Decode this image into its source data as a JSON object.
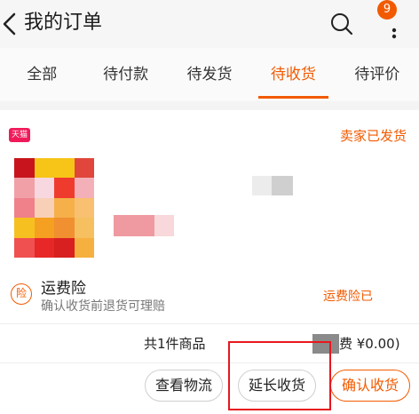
{
  "header": {
    "title": "我的订单",
    "badge": "9"
  },
  "tabs": [
    {
      "label": "全部",
      "active": false
    },
    {
      "label": "待付款",
      "active": false
    },
    {
      "label": "待发货",
      "active": false
    },
    {
      "label": "待收货",
      "active": true
    },
    {
      "label": "待评价",
      "active": false
    }
  ],
  "order": {
    "shop_logo": "天猫",
    "status": "卖家已发货",
    "insurance": {
      "icon_text": "险",
      "title": "运费险",
      "subtitle": "确认收货前退货可理赔",
      "status": "运费险已"
    },
    "summary": {
      "count": "共1件商品",
      "freight": "费 ¥0.00)"
    },
    "buttons": {
      "logistics": "查看物流",
      "extend": "延长收货",
      "confirm": "确认收货"
    }
  },
  "colors": {
    "accent": "#f25a00",
    "highlight": "#e8171d"
  }
}
